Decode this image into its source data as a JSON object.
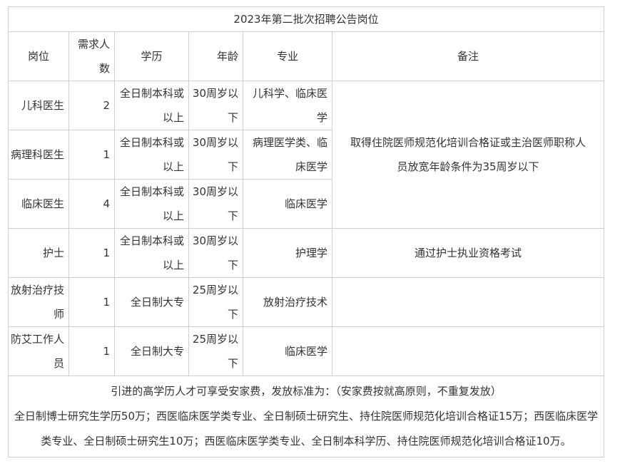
{
  "table": {
    "title": "2023年第二批次招聘公告岗位",
    "headers": {
      "position": "岗位",
      "count": "需求人数",
      "education": "学历",
      "age": "年龄",
      "major": "专业",
      "remarks": "备注"
    },
    "rows": [
      {
        "position": "儿科医生",
        "count": "2",
        "education": "全日制本科或以上",
        "age": "30周岁以下",
        "major": "儿科学、临床医学"
      },
      {
        "position": "病理科医生",
        "count": "1",
        "education": "全日制本科或以上",
        "age": "30周岁以下",
        "major": "病理医学类、临床医学"
      },
      {
        "position": "临床医生",
        "count": "4",
        "education": "全日制本科或以上",
        "age": "30周岁以下",
        "major": "临床医学"
      },
      {
        "position": "护士",
        "count": "1",
        "education": "全日制本科或以上",
        "age": "30周岁以下",
        "major": "护理学"
      },
      {
        "position": "放射治疗技师",
        "count": "1",
        "education": "全日制大专",
        "age": "25周岁以下",
        "major": "放射治疗技术"
      },
      {
        "position": "防艾工作人员",
        "count": "1",
        "education": "全日制大专",
        "age": "25周岁以下",
        "major": "临床医学"
      }
    ],
    "remark_doctors": "取得住院医师规范化培训合格证或主治医师职称人员放宽年龄条件为35周岁以下",
    "remark_nurse": "通过护士执业资格考试",
    "footer_line1": "引进的高学历人才可享受安家费，发放标准为：（安家费按就高原则，不重复发放）",
    "footer_line2": "全日制博士研究生学历50万；西医临床医学类专业、全日制硕士研究生、持住院医师规范化培训合格证15万；西医临床医学类专业、全日制硕士研究生10万；西医临床医学类专业、全日制本科学历、持住院医师规范化培训合格证10万。"
  }
}
